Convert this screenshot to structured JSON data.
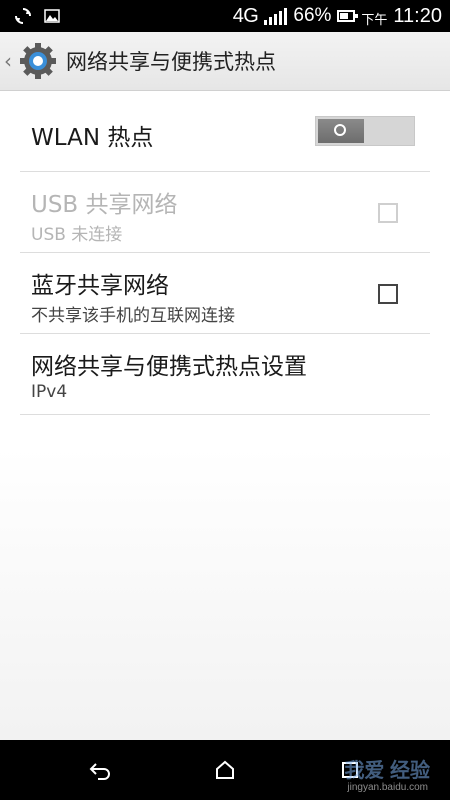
{
  "status_bar": {
    "network": "4G",
    "network_small": "4G",
    "battery": "66%",
    "battery_level": 0.66,
    "ampm": "下午",
    "time": "11:20"
  },
  "header": {
    "title": "网络共享与便携式热点"
  },
  "settings": {
    "wlan_hotspot": {
      "label": "WLAN 热点",
      "enabled": false
    },
    "usb_tethering": {
      "label": "USB 共享网络",
      "summary": "USB 未连接",
      "checked": false,
      "disabled": true
    },
    "bluetooth_tethering": {
      "label": "蓝牙共享网络",
      "summary": "不共享该手机的互联网连接",
      "checked": false
    },
    "tethering_settings": {
      "label": "网络共享与便携式热点设置",
      "summary": "IPv4"
    }
  },
  "watermark": {
    "text": "我爱  经验",
    "url": "jingyan.baidu.com"
  }
}
